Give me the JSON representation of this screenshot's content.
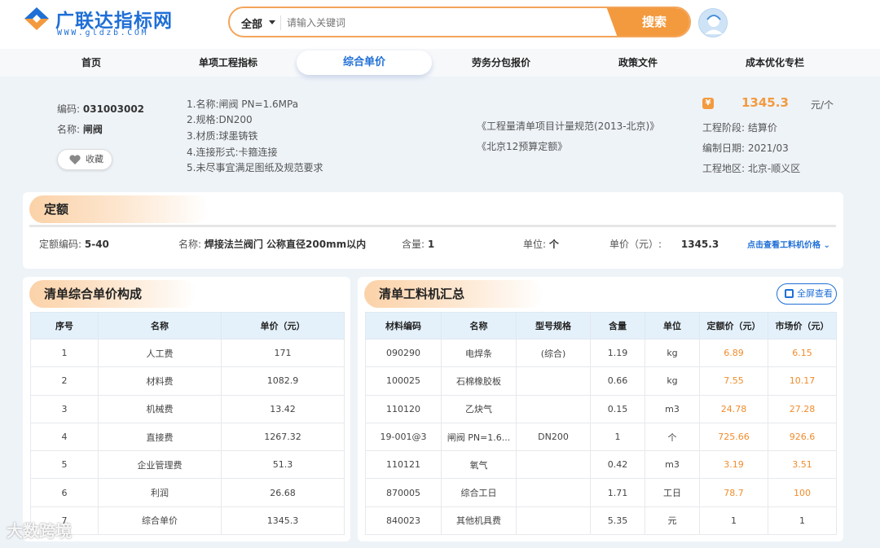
{
  "header": {
    "logo_title": "广联达指标网",
    "logo_sub": "WWW.gldzb.COM",
    "search_scope": "全部",
    "search_placeholder": "请输入关键词",
    "search_button": "搜索"
  },
  "nav": {
    "items": [
      {
        "label": "首页"
      },
      {
        "label": "单项工程指标"
      },
      {
        "label": "综合单价"
      },
      {
        "label": "劳务分包报价"
      },
      {
        "label": "政策文件"
      },
      {
        "label": "成本优化专栏"
      }
    ],
    "active_index": 2
  },
  "item": {
    "code_label": "编码:",
    "code": "031003002",
    "name_label": "名称:",
    "name": "闸阀",
    "favorite": "收藏",
    "features": [
      "1.名称:闸阀 PN=1.6MPa",
      "2.规格:DN200",
      "3.材质:球墨铸铁",
      "4.连接形式:卡箍连接",
      "5.未尽事宜满足图纸及规范要求"
    ],
    "standards": [
      "《工程量清单项目计量规范(2013-北京)》",
      "《北京12预算定额》"
    ],
    "price": "1345.3",
    "price_unit": "元/个",
    "stage_label": "工程阶段:",
    "stage": "结算价",
    "date_label": "编制日期:",
    "date": "2021/03",
    "region_label": "工程地区:",
    "region": "北京-顺义区"
  },
  "quota": {
    "title": "定额",
    "code_label": "定额编码:",
    "code": "5-40",
    "name_label": "名称:",
    "name": "焊接法兰阀门 公称直径200mm以内",
    "qty_label": "含量:",
    "qty": "1",
    "unit_label": "单位:",
    "unit": "个",
    "price_label": "单价（元）:",
    "price": "1345.3",
    "link": "点击查看工料机价格"
  },
  "composition": {
    "title": "清单综合单价构成",
    "headers": [
      "序号",
      "名称",
      "单价（元）"
    ],
    "rows": [
      [
        "1",
        "人工费",
        "171"
      ],
      [
        "2",
        "材料费",
        "1082.9"
      ],
      [
        "3",
        "机械费",
        "13.42"
      ],
      [
        "4",
        "直接费",
        "1267.32"
      ],
      [
        "5",
        "企业管理费",
        "51.3"
      ],
      [
        "6",
        "利润",
        "26.68"
      ],
      [
        "7",
        "综合单价",
        "1345.3"
      ]
    ]
  },
  "materials": {
    "title": "清单工料机汇总",
    "fullscreen": "全屏查看",
    "headers": [
      "材料编码",
      "名称",
      "型号规格",
      "含量",
      "单位",
      "定额价（元）",
      "市场价（元）"
    ],
    "rows": [
      [
        "090290",
        "电焊条",
        "(综合)",
        "1.19",
        "kg",
        "6.89",
        "6.15"
      ],
      [
        "100025",
        "石棉橡胶板",
        "",
        "0.66",
        "kg",
        "7.55",
        "10.17"
      ],
      [
        "110120",
        "乙炔气",
        "",
        "0.15",
        "m3",
        "24.78",
        "27.28"
      ],
      [
        "19-001@3",
        "闸阀 PN=1.6...",
        "DN200",
        "1",
        "个",
        "725.66",
        "926.6"
      ],
      [
        "110121",
        "氧气",
        "",
        "0.42",
        "m3",
        "3.19",
        "3.51"
      ],
      [
        "870005",
        "综合工日",
        "",
        "1.71",
        "工日",
        "78.7",
        "100"
      ],
      [
        "840023",
        "其他机具费",
        "",
        "5.35",
        "元",
        "1",
        "1"
      ]
    ]
  },
  "watermark": "大数跨境",
  "colors": {
    "accent": "#f39a3e",
    "brand": "#1f6fd6",
    "header_fill": "#e4f1fb"
  }
}
